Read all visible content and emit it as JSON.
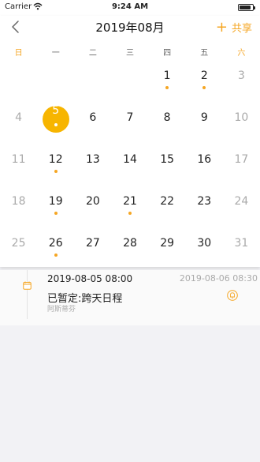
{
  "status_bar": {
    "carrier": "Carrier",
    "time": "9:24 AM",
    "battery_level": 0.9
  },
  "nav": {
    "title": "2019年08月",
    "share_label": "共享"
  },
  "weekdays": [
    "日",
    "一",
    "二",
    "三",
    "四",
    "五",
    "六"
  ],
  "calendar": {
    "selected": "5",
    "weeks": [
      [
        {
          "day": "",
          "muted": false,
          "dot": false
        },
        {
          "day": "",
          "muted": false,
          "dot": false
        },
        {
          "day": "",
          "muted": false,
          "dot": false
        },
        {
          "day": "",
          "muted": false,
          "dot": false
        },
        {
          "day": "1",
          "muted": false,
          "dot": true
        },
        {
          "day": "2",
          "muted": false,
          "dot": true
        },
        {
          "day": "3",
          "muted": true,
          "dot": false
        }
      ],
      [
        {
          "day": "4",
          "muted": true,
          "dot": false
        },
        {
          "day": "5",
          "muted": false,
          "dot": true,
          "selected": true
        },
        {
          "day": "6",
          "muted": false,
          "dot": false
        },
        {
          "day": "7",
          "muted": false,
          "dot": false
        },
        {
          "day": "8",
          "muted": false,
          "dot": false
        },
        {
          "day": "9",
          "muted": false,
          "dot": false
        },
        {
          "day": "10",
          "muted": true,
          "dot": false
        }
      ],
      [
        {
          "day": "11",
          "muted": true,
          "dot": false
        },
        {
          "day": "12",
          "muted": false,
          "dot": true
        },
        {
          "day": "13",
          "muted": false,
          "dot": false
        },
        {
          "day": "14",
          "muted": false,
          "dot": false
        },
        {
          "day": "15",
          "muted": false,
          "dot": false
        },
        {
          "day": "16",
          "muted": false,
          "dot": false
        },
        {
          "day": "17",
          "muted": true,
          "dot": false
        }
      ],
      [
        {
          "day": "18",
          "muted": true,
          "dot": false
        },
        {
          "day": "19",
          "muted": false,
          "dot": true
        },
        {
          "day": "20",
          "muted": false,
          "dot": false
        },
        {
          "day": "21",
          "muted": false,
          "dot": true
        },
        {
          "day": "22",
          "muted": false,
          "dot": false
        },
        {
          "day": "23",
          "muted": false,
          "dot": false
        },
        {
          "day": "24",
          "muted": true,
          "dot": false
        }
      ],
      [
        {
          "day": "25",
          "muted": true,
          "dot": false
        },
        {
          "day": "26",
          "muted": false,
          "dot": true
        },
        {
          "day": "27",
          "muted": false,
          "dot": false
        },
        {
          "day": "28",
          "muted": false,
          "dot": false
        },
        {
          "day": "29",
          "muted": false,
          "dot": false
        },
        {
          "day": "30",
          "muted": false,
          "dot": false
        },
        {
          "day": "31",
          "muted": true,
          "dot": false
        }
      ]
    ]
  },
  "event": {
    "start": "2019-08-05 08:00",
    "end": "2019-08-06 08:30",
    "title": "已暂定:跨天日程",
    "subtitle": "阿斯蒂芬"
  },
  "colors": {
    "accent": "#f5a623",
    "selected_fill": "#f7b500",
    "muted_text": "#aaaaaa"
  },
  "icons": [
    "back-chevron-icon",
    "plus-icon",
    "calendar-icon",
    "bell-icon",
    "wifi-icon",
    "battery-icon"
  ]
}
